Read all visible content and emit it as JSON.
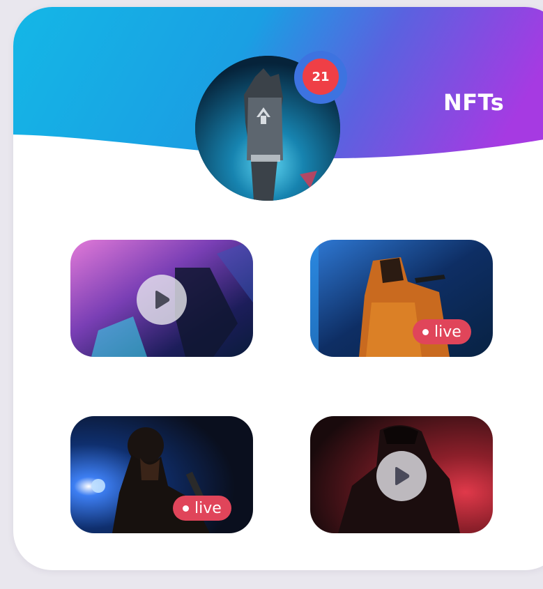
{
  "header": {
    "title": "NFTs",
    "notification_count": "21"
  },
  "tiles": [
    {
      "type": "video",
      "icon": "play-icon"
    },
    {
      "type": "live",
      "badge_label": "live"
    },
    {
      "type": "live",
      "badge_label": "live"
    },
    {
      "type": "video",
      "icon": "play-icon"
    }
  ],
  "colors": {
    "header_gradient_start": "#16b6e6",
    "header_gradient_end": "#a03be0",
    "badge_red": "#ef3f46",
    "badge_ring": "#3d73e0",
    "live_red": "#e0455a"
  }
}
